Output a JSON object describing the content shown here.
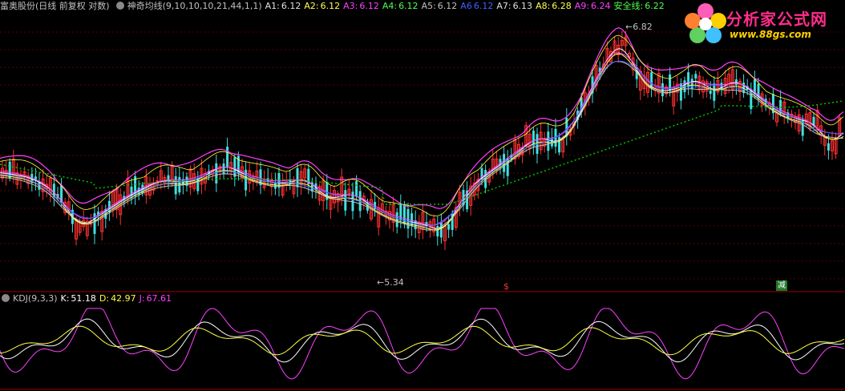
{
  "header": {
    "stock": "富奥股份(日线 前复权 对数)",
    "indicator": "神奇均线(9,10,10,10,21,44,1,1)",
    "values": [
      {
        "label": "A1:",
        "value": "6.12",
        "color": "#e0e0e0"
      },
      {
        "label": "A2:",
        "value": "6.12",
        "color": "#ffff50"
      },
      {
        "label": "A3:",
        "value": "6.12",
        "color": "#ff40ff"
      },
      {
        "label": "A4:",
        "value": "6.12",
        "color": "#50ff50"
      },
      {
        "label": "A5:",
        "value": "6.12",
        "color": "#c0c0c0"
      },
      {
        "label": "A6",
        "value": "6.12",
        "color": "#4060ff"
      },
      {
        "label": "A7:",
        "value": "6.13",
        "color": "#e0e0e0"
      },
      {
        "label": "A8:",
        "value": "6.28",
        "color": "#ffff50"
      },
      {
        "label": "A9:",
        "value": "6.24",
        "color": "#ff40ff"
      },
      {
        "label": "安全线:",
        "value": "6.22",
        "color": "#50ff50"
      }
    ]
  },
  "price_labels": {
    "high": "6.82",
    "low": "5.34"
  },
  "signals": {
    "buy": "$",
    "sell": "减"
  },
  "kdj": {
    "title": "KDJ(9,3,3)",
    "k_label": "K:",
    "k_value": "51.18",
    "d_label": "D:",
    "d_value": "42.97",
    "j_label": "J:",
    "j_value": "67.61"
  },
  "logo": {
    "text": "分析家公式网",
    "url": "www.88gs.com"
  },
  "colors": {
    "up": "#ff3030",
    "down": "#40e0e0",
    "ma_white": "#ffffff",
    "ma_yellow": "#ffff40",
    "ma_magenta": "#ff40ff",
    "safety": "#00c000",
    "kdj_k": "#ffffff",
    "kdj_d": "#ffff40",
    "kdj_j": "#ff40ff"
  }
}
